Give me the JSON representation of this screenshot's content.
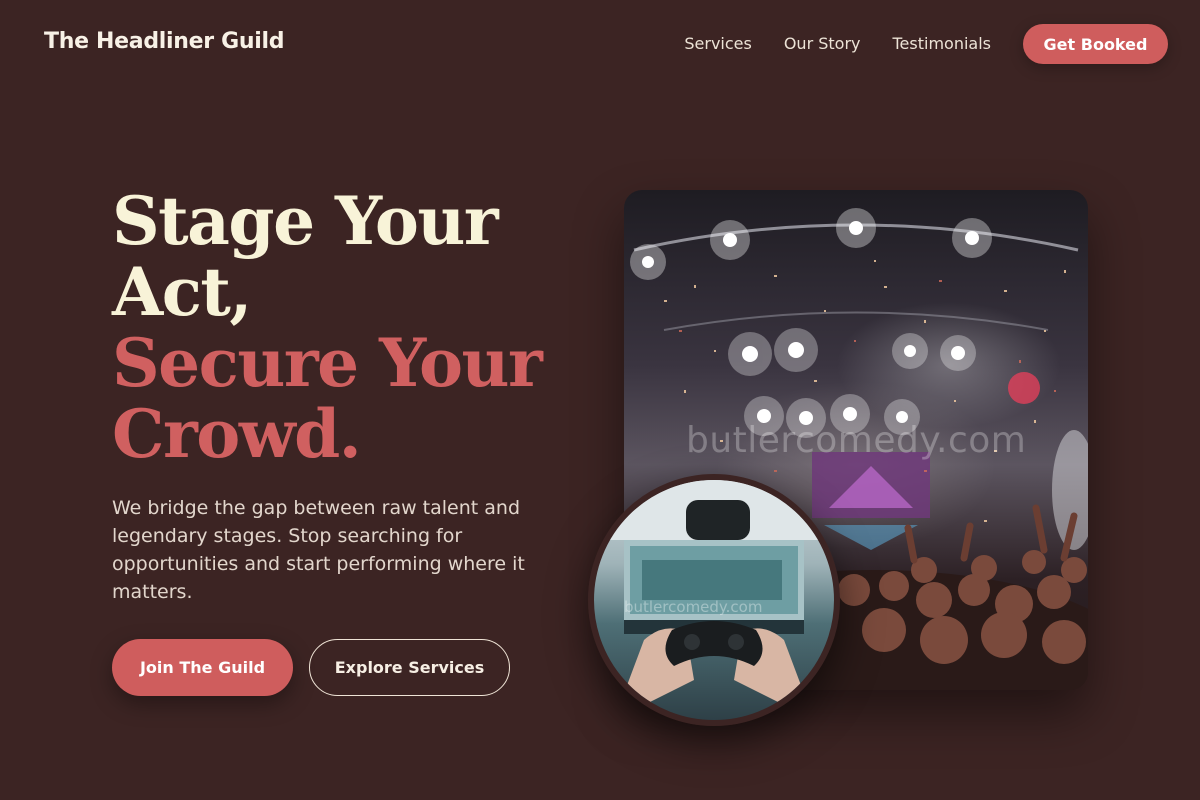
{
  "header": {
    "brand": "The Headliner Guild",
    "nav": [
      {
        "label": "Services"
      },
      {
        "label": "Our Story"
      },
      {
        "label": "Testimonials"
      }
    ],
    "cta_label": "Get Booked"
  },
  "hero": {
    "title_lines": [
      "Stage Your",
      "Act,"
    ],
    "title_accent_lines": [
      "Secure Your",
      "Crowd."
    ],
    "description": "We bridge the gap between raw talent and legendary stages. Stop searching for opportunities and start performing where it matters.",
    "primary_cta": "Join The Guild",
    "secondary_cta": "Explore Services",
    "watermark": "butlercomedy.com",
    "watermark_small": "butlercomedy.com"
  },
  "colors": {
    "background": "#3c2423",
    "accent": "#cf5d5d",
    "cream": "#f8f3d8"
  }
}
